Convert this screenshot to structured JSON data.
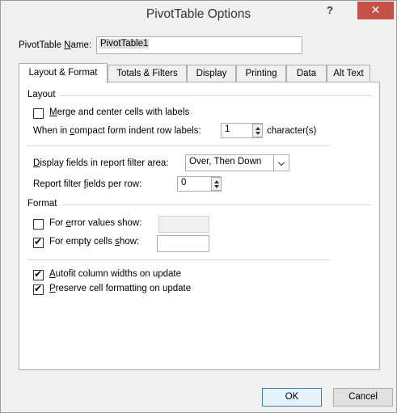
{
  "window": {
    "title": "PivotTable Options",
    "help": "?",
    "close": "✕"
  },
  "name_field": {
    "label_prefix": "PivotTable ",
    "label_accel": "N",
    "label_rest": "ame:",
    "value": "PivotTable1"
  },
  "tabs": [
    {
      "label": "Layout & Format",
      "active": true
    },
    {
      "label": "Totals & Filters"
    },
    {
      "label": "Display"
    },
    {
      "label": "Printing"
    },
    {
      "label": "Data"
    },
    {
      "label": "Alt Text"
    }
  ],
  "layout_section": {
    "title": "Layout",
    "merge_center": {
      "accel": "M",
      "rest": "erge and center cells with labels",
      "checked": false
    },
    "indent": {
      "prefix": "When in ",
      "accel": "c",
      "rest": "ompact form indent row labels:",
      "value": "1",
      "suffix": "character(s)"
    },
    "display_fields": {
      "accel": "D",
      "rest": "isplay fields in report filter area:",
      "value": "Over, Then Down"
    },
    "filter_per_row": {
      "prefix": "Report filter ",
      "accel": "f",
      "rest": "ields per row:",
      "value": "0"
    }
  },
  "format_section": {
    "title": "Format",
    "error_values": {
      "prefix": "For ",
      "accel": "e",
      "rest": "rror values show:",
      "checked": false
    },
    "empty_cells": {
      "prefix": "For empty cells ",
      "accel": "s",
      "rest": "how:",
      "checked": true
    },
    "autofit": {
      "accel": "A",
      "rest": "utofit column widths on update",
      "checked": true
    },
    "preserve": {
      "accel": "P",
      "rest": "reserve cell formatting on update",
      "checked": true
    }
  },
  "buttons": {
    "ok": "OK",
    "cancel": "Cancel"
  }
}
